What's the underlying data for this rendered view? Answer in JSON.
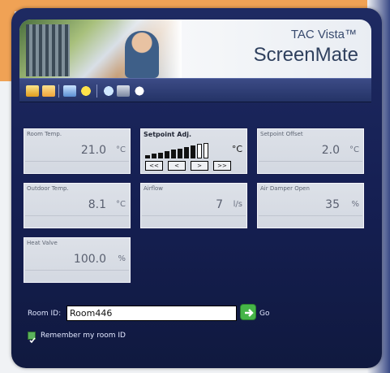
{
  "window": {
    "brand_line1": "TAC Vista™",
    "brand_line2": "ScreenMate"
  },
  "toolbar": {
    "icons": [
      "enter-icon",
      "folder-icon",
      "list-icon",
      "star-icon",
      "help-icon",
      "wrench-icon",
      "info-icon"
    ]
  },
  "tiles": [
    {
      "label": "Room Temp.",
      "value": "21.0",
      "unit": "°C"
    },
    {
      "label": "Setpoint Adj.",
      "unit": "°C"
    },
    {
      "label": "Setpoint Offset",
      "value": "2.0",
      "unit": "°C"
    },
    {
      "label": "Outdoor Temp.",
      "value": "8.1",
      "unit": "°C"
    },
    {
      "label": "Airflow",
      "value": "7",
      "unit": "l/s"
    },
    {
      "label": "Air Damper Open",
      "value": "35",
      "unit": "%"
    },
    {
      "label": "Heat Valve",
      "value": "100.0",
      "unit": "%"
    }
  ],
  "setpoint_controls": {
    "buttons": [
      "<<",
      "<",
      ">",
      ">>"
    ],
    "level_fraction": 0.75
  },
  "room": {
    "label": "Room ID:",
    "value": "Room446",
    "go_label": "Go"
  },
  "remember": {
    "label": "Remember my room ID",
    "checked": true
  },
  "colors": {
    "panel": "#1b2658",
    "accent_orange": "#f0a255",
    "go_green": "#46b548"
  }
}
